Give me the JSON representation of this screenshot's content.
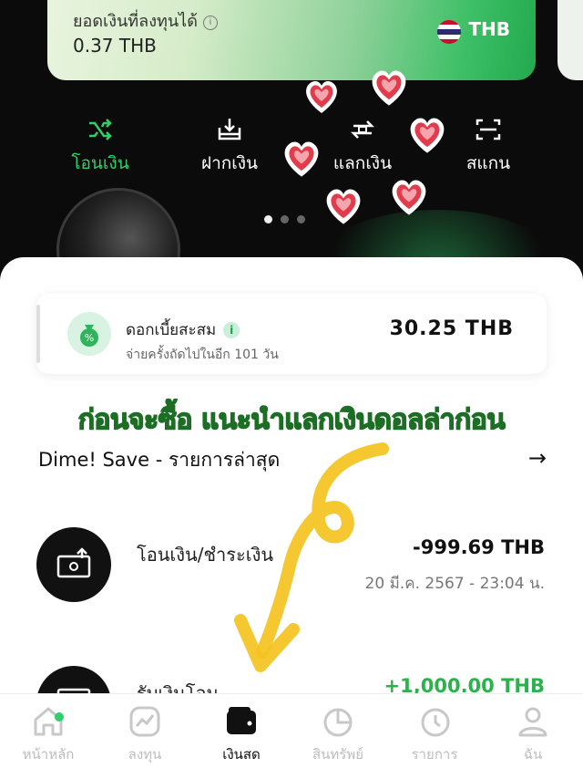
{
  "card": {
    "label": "ยอดเงินที่ลงทุนได้",
    "amount": "0.37 THB",
    "currency": "THB",
    "info_icon": "i"
  },
  "actions": [
    {
      "label": "โอนเงิน",
      "icon": "shuffle-icon"
    },
    {
      "label": "ฝากเงิน",
      "icon": "deposit-icon"
    },
    {
      "label": "แลกเงิน",
      "icon": "exchange-icon"
    },
    {
      "label": "สแกน",
      "icon": "scan-icon"
    }
  ],
  "interest": {
    "title": "ดอกเบี้ยสะสม",
    "info": "i",
    "subtitle": "จ่ายครั้งถัดไปในอีก 101 วัน",
    "amount": "30.25  THB"
  },
  "overlay_text": "ก่อนจะซื้อ แนะนำแลกเงินดอลล่าก่อน",
  "section": {
    "title": "Dime! Save - รายการล่าสุด",
    "arrow": "→"
  },
  "transactions": [
    {
      "title": "โอนเงิน/ชำระเงิน",
      "amount": "-999.69 THB",
      "date": "20 มี.ค. 2567 - 23:04 น."
    },
    {
      "title": "รับเงินโอน",
      "amount": "+1,000.00 THB"
    }
  ],
  "nav": [
    {
      "label": "หน้าหลัก",
      "icon": "home-icon"
    },
    {
      "label": "ลงทุน",
      "icon": "invest-icon"
    },
    {
      "label": "เงินสด",
      "icon": "wallet-icon"
    },
    {
      "label": "สินทรัพย์",
      "icon": "assets-icon"
    },
    {
      "label": "รายการ",
      "icon": "history-icon"
    },
    {
      "label": "ฉัน",
      "icon": "profile-icon"
    }
  ],
  "colors": {
    "accent": "#2fd067",
    "positive": "#2bb24c",
    "overlay_text": "#e8f060"
  }
}
